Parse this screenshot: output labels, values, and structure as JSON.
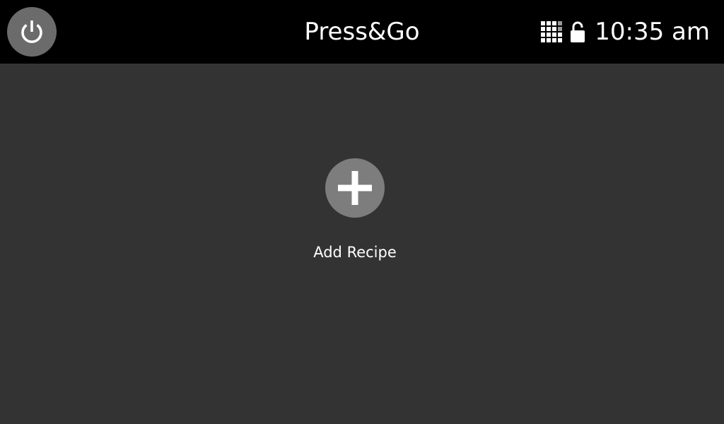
{
  "header": {
    "title": "Press&Go",
    "time": "10:35 am",
    "power_icon": "power-icon",
    "keypad_icon": "keypad-icon",
    "lock_icon": "unlocked-padlock-icon",
    "background_color": "#000000"
  },
  "main": {
    "add_recipe_label": "Add Recipe",
    "add_icon": "plus-icon",
    "background_color": "#333333",
    "button_color": "#7d7d7d"
  }
}
